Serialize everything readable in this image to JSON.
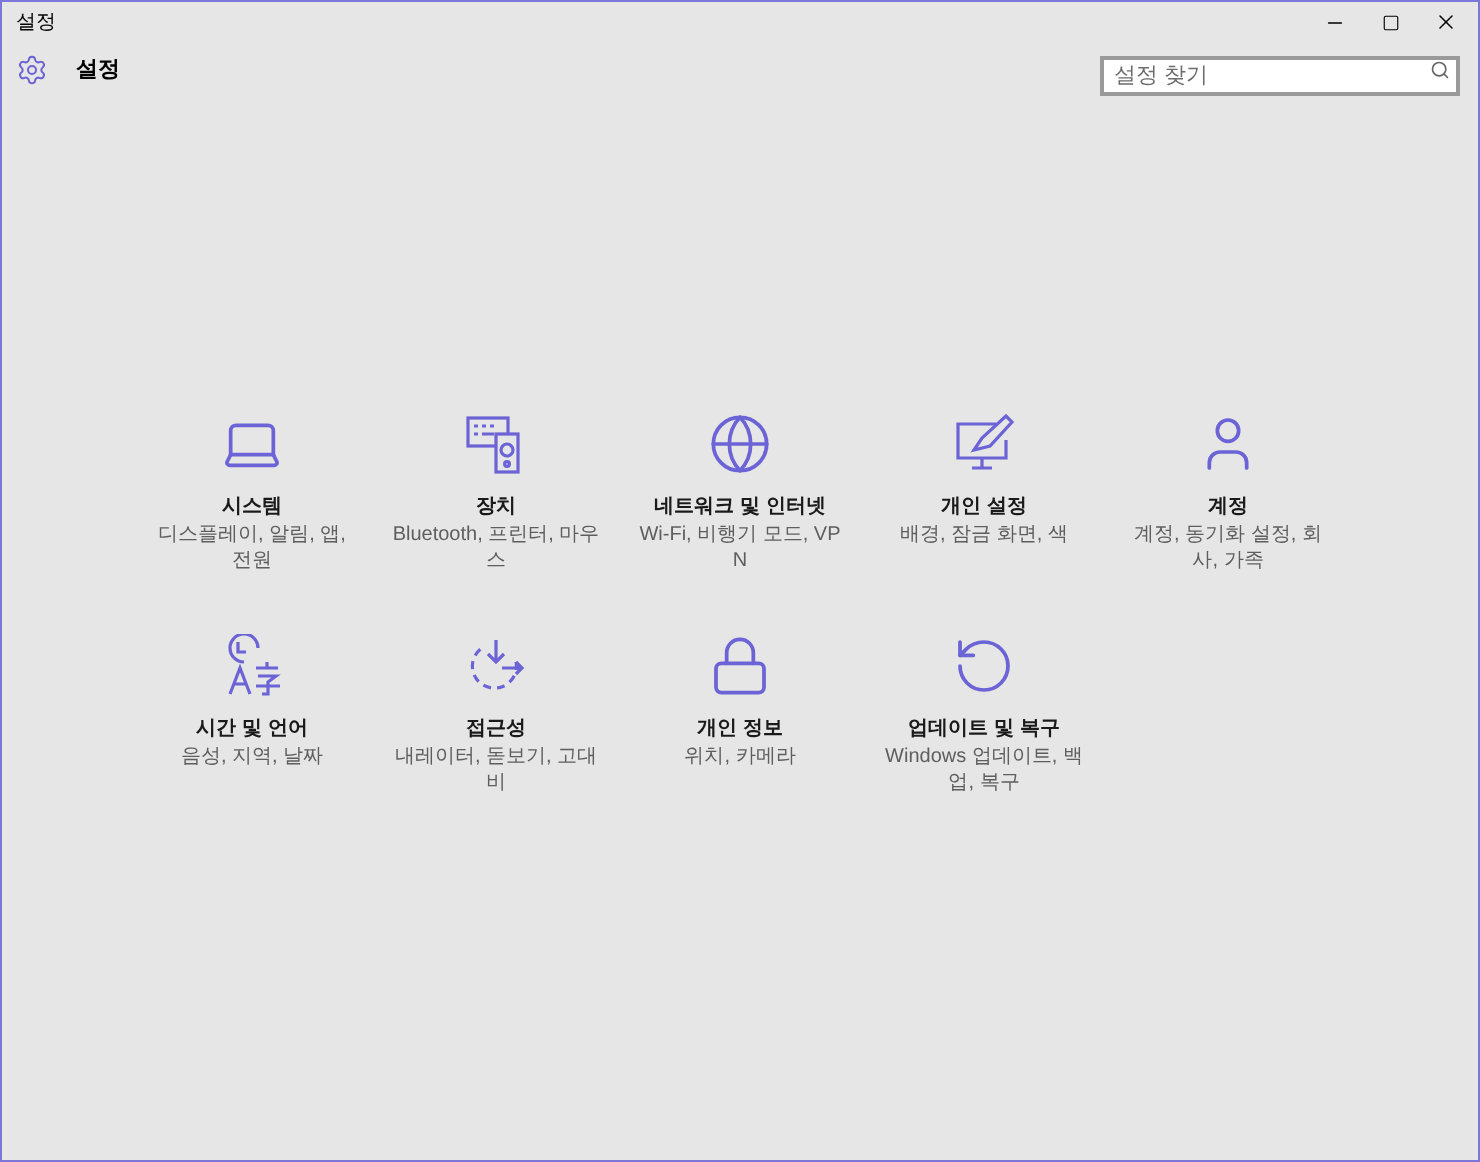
{
  "window": {
    "title": "설정"
  },
  "header": {
    "title": "설정"
  },
  "search": {
    "placeholder": "설정 찾기"
  },
  "tiles": [
    {
      "title": "시스템",
      "description": "디스플레이, 알림, 앱, 전원"
    },
    {
      "title": "장치",
      "description": "Bluetooth, 프린터, 마우스"
    },
    {
      "title": "네트워크 및 인터넷",
      "description": "Wi-Fi, 비행기 모드, VPN"
    },
    {
      "title": "개인 설정",
      "description": "배경, 잠금 화면, 색"
    },
    {
      "title": "계정",
      "description": "계정, 동기화 설정, 회사, 가족"
    },
    {
      "title": "시간 및 언어",
      "description": "음성, 지역, 날짜"
    },
    {
      "title": "접근성",
      "description": "내레이터, 돋보기, 고대비"
    },
    {
      "title": "개인 정보",
      "description": "위치, 카메라"
    },
    {
      "title": "업데이트 및 복구",
      "description": "Windows 업데이트, 백업, 복구"
    }
  ]
}
